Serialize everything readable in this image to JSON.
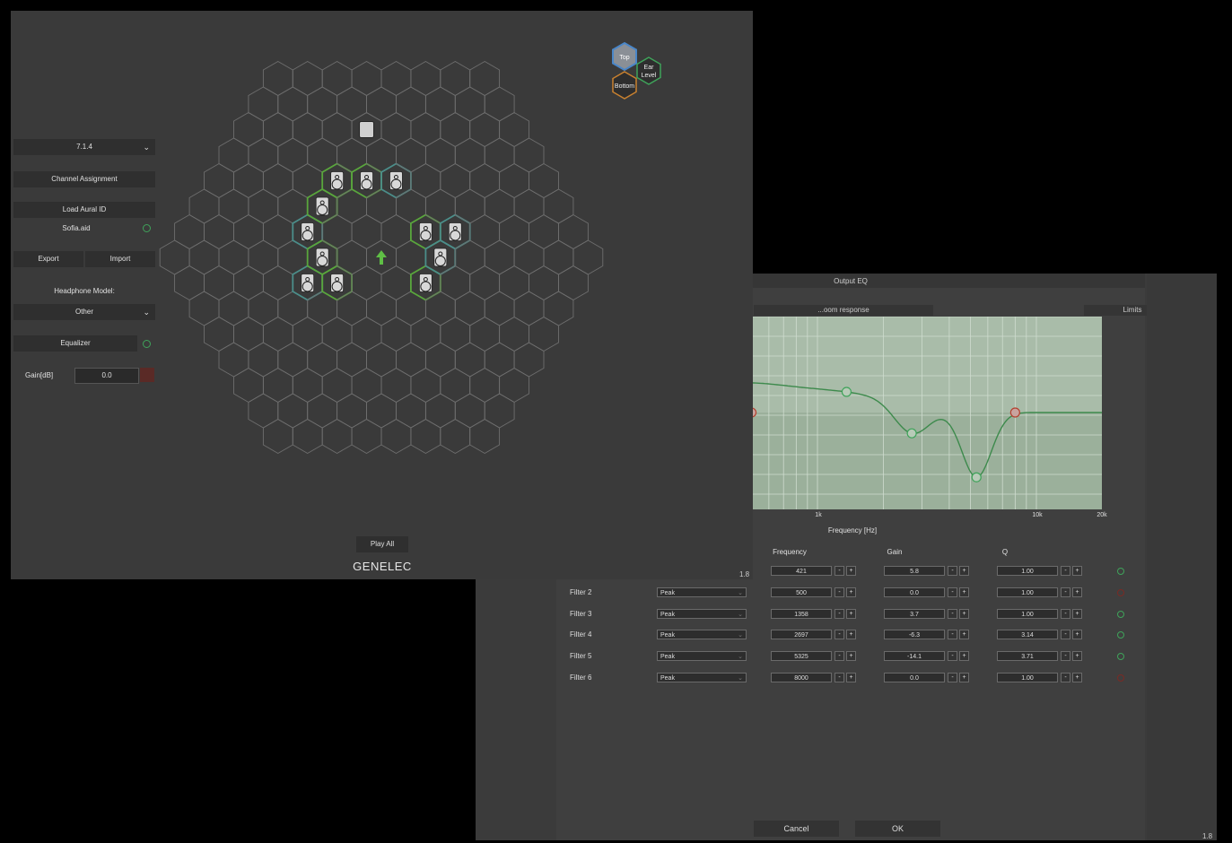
{
  "main": {
    "layout_select": "7.1.4",
    "channel_assignment": "Channel Assignment",
    "load_aural_id": "Load Aural ID",
    "aural_file": "Sofia.aid",
    "export": "Export",
    "import": "Import",
    "headphone_model_label": "Headphone Model:",
    "headphone_model": "Other",
    "equalizer": "Equalizer",
    "gain_label": "Gain[dB]",
    "gain_value": "0.0",
    "play_all": "Play All",
    "brand": "GENELEC",
    "view_top": "Top",
    "view_ear_level_1": "Ear",
    "view_ear_level_2": "Level",
    "view_bottom": "Bottom"
  },
  "eq": {
    "title": "Output EQ",
    "tab_left": "...oom response",
    "tab_limits": "Limits",
    "xlabel": "Frequency [Hz]",
    "xticks": [
      "1k",
      "10k",
      "20k"
    ],
    "col_frequency": "Frequency",
    "col_gain": "Gain",
    "col_q": "Q",
    "filters": [
      {
        "label": "",
        "type": "",
        "freq": "421",
        "gain": "5.8",
        "q": "1.00",
        "on": true
      },
      {
        "label": "Filter 2",
        "type": "Peak",
        "freq": "500",
        "gain": "0.0",
        "q": "1.00",
        "on": false
      },
      {
        "label": "Filter 3",
        "type": "Peak",
        "freq": "1358",
        "gain": "3.7",
        "q": "1.00",
        "on": true
      },
      {
        "label": "Filter 4",
        "type": "Peak",
        "freq": "2697",
        "gain": "-6.3",
        "q": "3.14",
        "on": true
      },
      {
        "label": "Filter 5",
        "type": "Peak",
        "freq": "5325",
        "gain": "-14.1",
        "q": "3.71",
        "on": true
      },
      {
        "label": "Filter 6",
        "type": "Peak",
        "freq": "8000",
        "gain": "0.0",
        "q": "1.00",
        "on": false
      }
    ],
    "cancel": "Cancel",
    "ok": "OK",
    "minus": "-",
    "plus": "+",
    "corner_mark": "1.8",
    "colors": {
      "on": "#3fa35a",
      "off": "#7a2a24"
    }
  }
}
